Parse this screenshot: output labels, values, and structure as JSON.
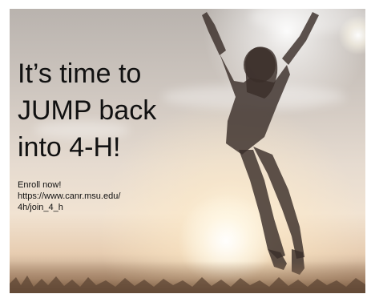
{
  "poster": {
    "headline_lines": [
      "It’s time to",
      "JUMP back",
      "into 4-H!"
    ],
    "enroll_lines": [
      "Enroll now!",
      "https://www.canr.msu.edu/",
      "4h/join_4_h"
    ]
  },
  "colors": {
    "text": "#111111",
    "sky": "#cfc7c0",
    "glow": "#f1e3d2",
    "silhouette": "#3a2e2a"
  }
}
